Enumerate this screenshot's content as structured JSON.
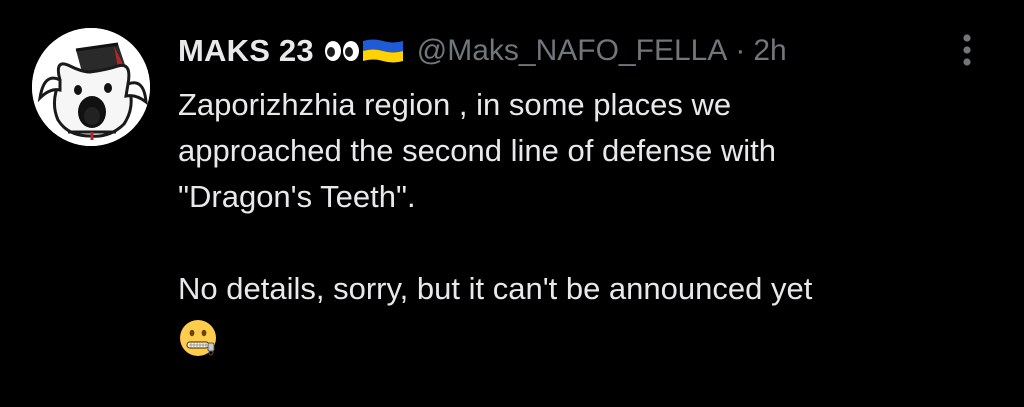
{
  "tweet": {
    "author": {
      "display_name": "MAKS 23",
      "name_emoji": [
        "eyes-icon",
        "ukraine-flag-icon"
      ],
      "handle": "@Maks_NAFO_FELLA",
      "separator": "·",
      "timestamp": "2h",
      "avatar": "nafo-shiba-avatar"
    },
    "text_lines": [
      "Zaporizhzhia region , in some places we",
      "approached the second line of defense with",
      "\"Dragon's Teeth\".",
      "",
      "No details, sorry, but it can't be announced yet"
    ],
    "trailing_emoji": "zipper-mouth-face-icon",
    "more_menu_icon": "more-vertical-icon"
  },
  "colors": {
    "background": "#000000",
    "primary_text": "#e7e9ea",
    "secondary_text": "#71767b",
    "flag_blue": "#1f5bd6",
    "flag_yellow": "#ffd200"
  }
}
